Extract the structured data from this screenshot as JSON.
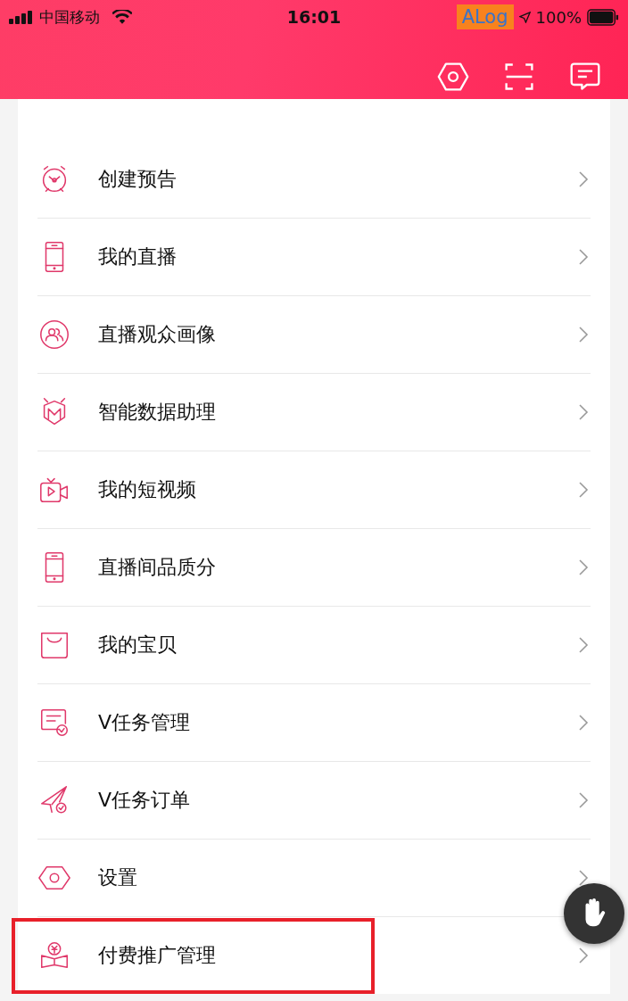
{
  "status_bar": {
    "carrier": "中国移动",
    "time": "16:01",
    "debug_tag": "ALog",
    "battery": "100%"
  },
  "items": [
    {
      "label": "创建预告",
      "highlighted": false
    },
    {
      "label": "我的直播",
      "highlighted": false
    },
    {
      "label": "直播观众画像",
      "highlighted": false
    },
    {
      "label": "智能数据助理",
      "highlighted": false
    },
    {
      "label": "我的短视频",
      "highlighted": false
    },
    {
      "label": "直播间品质分",
      "highlighted": false
    },
    {
      "label": "我的宝贝",
      "highlighted": false
    },
    {
      "label": "V任务管理",
      "highlighted": false
    },
    {
      "label": "V任务订单",
      "highlighted": false
    },
    {
      "label": "设置",
      "highlighted": false
    },
    {
      "label": "付费推广管理",
      "highlighted": true
    }
  ]
}
